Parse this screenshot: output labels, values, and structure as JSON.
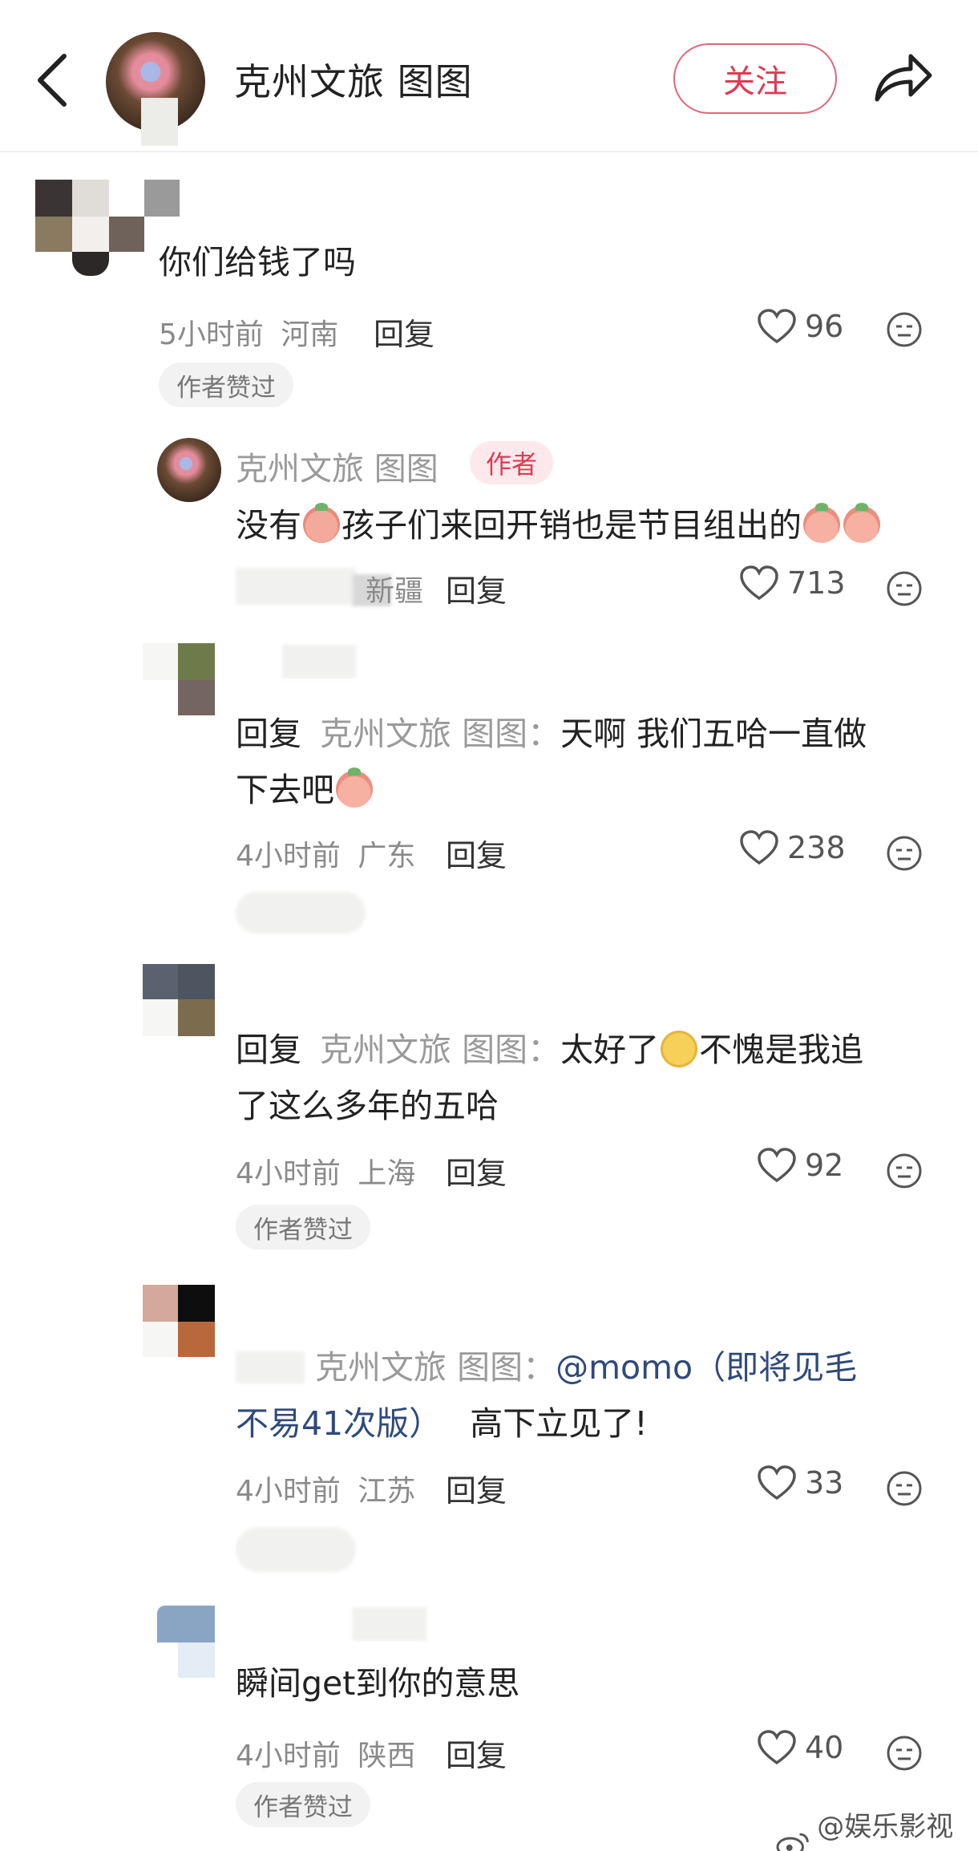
{
  "header": {
    "account_name": "克州文旅 图图",
    "follow_label": "关注"
  },
  "comments": [
    {
      "text": "你们给钱了吗",
      "time": "5小时前",
      "location": "河南",
      "reply_label": "回复",
      "likes": "96",
      "badge": "作者赞过"
    },
    {
      "author": "克州文旅 图图",
      "author_tag": "作者",
      "text_before": "没有",
      "text_after": "孩子们来回开销也是节目组出的",
      "location": "新疆",
      "reply_label": "回复",
      "likes": "713"
    },
    {
      "reply_prefix": "回复",
      "reply_to": "克州文旅 图图：",
      "text_line1": "天啊  我们五哈一直做",
      "text_line2": "下去吧",
      "time": "4小时前",
      "location": "广东",
      "reply_label": "回复",
      "likes": "238"
    },
    {
      "reply_prefix": "回复",
      "reply_to": "克州文旅 图图：",
      "text_a": "太好了",
      "text_b": "不愧是我追",
      "text_line2": "了这么多年的五哈",
      "time": "4小时前",
      "location": "上海",
      "reply_label": "回复",
      "likes": "92",
      "badge": "作者赞过"
    },
    {
      "reply_to": "克州文旅 图图：",
      "mention_line1": "@momo（即将见毛",
      "mention_line2": "不易41次版）",
      "text_tail": "高下立见了!",
      "time": "4小时前",
      "location": "江苏",
      "reply_label": "回复",
      "likes": "33"
    },
    {
      "text": "瞬间get到你的意思",
      "time": "4小时前",
      "location": "陕西",
      "reply_label": "回复",
      "likes": "40",
      "badge": "作者赞过"
    }
  ],
  "watermark": "@娱乐影视爆",
  "colors": {
    "accent": "#e03a55",
    "author_badge_bg": "#fde8eb",
    "meta_text": "#8a8a8a",
    "mention_link": "#2f4a7a"
  }
}
